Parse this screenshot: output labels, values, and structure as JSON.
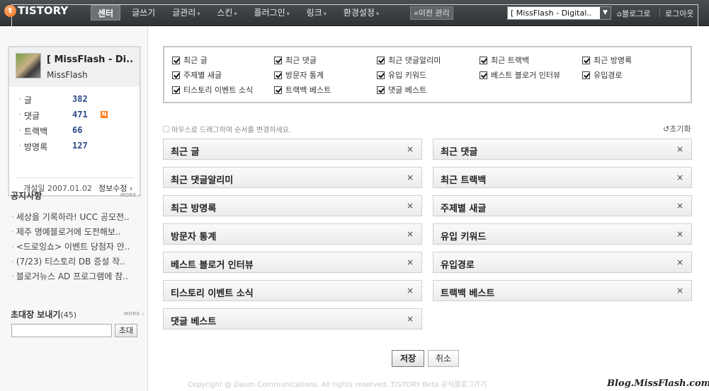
{
  "topbar": {
    "logo": "TISTORY",
    "logo_mark": "t",
    "nav": [
      {
        "label": "센터",
        "active": true,
        "caret": false
      },
      {
        "label": "글쓰기",
        "active": false,
        "caret": false
      },
      {
        "label": "글관리",
        "active": false,
        "caret": true
      },
      {
        "label": "스킨",
        "active": false,
        "caret": true
      },
      {
        "label": "플러그인",
        "active": false,
        "caret": true
      },
      {
        "label": "링크",
        "active": false,
        "caret": true
      },
      {
        "label": "환경설정",
        "active": false,
        "caret": true
      }
    ],
    "prev_manage": "«이전 관리",
    "blog_select": "[ MissFlash - Digital..",
    "to_blog": "블로그로",
    "logout": "로그아웃"
  },
  "sidebar": {
    "profile": {
      "blog_title": "[ MissFlash - Di..",
      "owner": "MissFlash",
      "stats": [
        {
          "label": "글",
          "value": "382",
          "new": false
        },
        {
          "label": "댓글",
          "value": "471",
          "new": true
        },
        {
          "label": "트랙백",
          "value": "66",
          "new": false
        },
        {
          "label": "방명록",
          "value": "127",
          "new": false
        }
      ],
      "new_badge": "N",
      "opened": "개설일 2007.01.02",
      "edit_info": "정보수정 ›"
    },
    "notices": {
      "title": "공지사항",
      "more": "MORE ›",
      "items": [
        "세상을 기록하라! UCC 공모전..",
        "제주 명예블로거에 도전해보..",
        "<드로잉쇼> 이벤트 당첨자 안..",
        "(7/23) 티스토리 DB 증설 작..",
        "블로거뉴스 AD 프로그램에 참.."
      ]
    },
    "invite": {
      "title": "초대장 보내기",
      "count": "(45)",
      "more": "MORE ›",
      "button": "초대"
    }
  },
  "main": {
    "checkboxes": [
      [
        "최근 글",
        "최근 댓글",
        "최근 댓글알리미",
        "최근 트랙백",
        "최근 방명록"
      ],
      [
        "주제별 새글",
        "방문자 통계",
        "유입 키워드",
        "베스트 블로거 인터뷰",
        "유입경로"
      ],
      [
        "티스토리 이벤트 소식",
        "트랙백 베스트",
        "댓글 베스트"
      ]
    ],
    "hint": "마우스로 드래그하여 순서를 변경하세요.",
    "reset": "↺초기화",
    "widgets_left": [
      "최근 글",
      "최근 댓글알리미",
      "최근 방명록",
      "방문자 통계",
      "베스트 블로거 인터뷰",
      "티스토리 이벤트 소식",
      "댓글 베스트"
    ],
    "widgets_right": [
      "최근 댓글",
      "최근 트랙백",
      "주제별 새글",
      "유입 키워드",
      "유입경로",
      "트랙백 베스트"
    ],
    "close_glyph": "×",
    "save": "저장",
    "cancel": "취소"
  },
  "footer": {
    "copyright": "Copyright @ Daum Communications. All rights reserved. TISTORY Beta 공식블로그가기",
    "watermark": "Blog.MissFlash.com"
  },
  "icons": {
    "logo": "tistory-logo-icon",
    "caret": "chevron-down-icon",
    "close": "close-icon",
    "check": "check-icon",
    "home": "home-icon",
    "reset": "reset-icon"
  }
}
